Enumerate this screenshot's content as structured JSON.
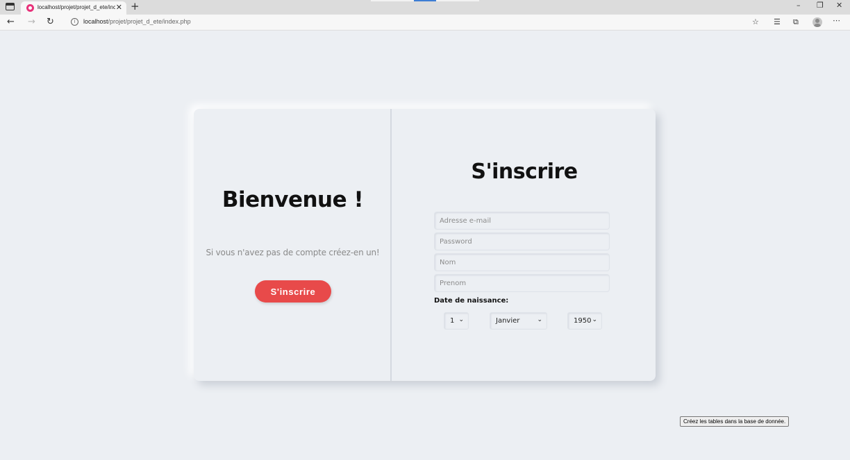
{
  "browser": {
    "tab_title": "localhost/projet/projet_d_ete/inc",
    "url_host": "localhost",
    "url_path": "/projet/projet_d_ete/index.php",
    "icons": [
      "tab-actions-icon",
      "favicon",
      "close-icon",
      "new-tab-icon",
      "minimize-icon",
      "restore-icon",
      "close-window-icon",
      "back-icon",
      "forward-icon",
      "refresh-icon",
      "info-icon",
      "favorite-icon",
      "favorites-list-icon",
      "collections-icon",
      "profile-icon",
      "more-icon"
    ]
  },
  "left_panel": {
    "title": "Bienvenue !",
    "text": "Si vous n'avez pas de compte créez-en un!",
    "button_label": "S'inscrire"
  },
  "form": {
    "title": "S'inscrire",
    "email_placeholder": "Adresse e-mail",
    "password_placeholder": "Password",
    "nom_placeholder": "Nom",
    "prenom_placeholder": "Prenom",
    "dob_label": "Date de naissance:",
    "day": "1",
    "month": "Janvier",
    "year": "1950"
  },
  "db_button_label": "Créez les tables dans la base de donnée.",
  "colors": {
    "background": "#eceff3",
    "accent_button": "#e84a4a",
    "favicon": "#e8327a"
  }
}
